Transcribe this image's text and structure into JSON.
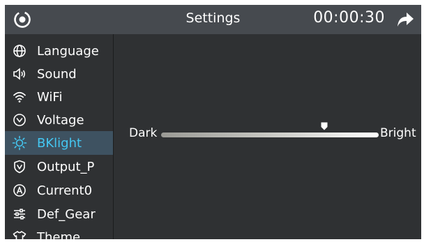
{
  "header": {
    "title": "Settings",
    "timer": "00:00:30"
  },
  "sidebar": {
    "items": [
      {
        "label": "Language",
        "icon": "globe-icon"
      },
      {
        "label": "Sound",
        "icon": "speaker-icon"
      },
      {
        "label": "WiFi",
        "icon": "wifi-icon"
      },
      {
        "label": "Voltage",
        "icon": "chevron-circle-icon"
      },
      {
        "label": "BKlight",
        "icon": "sun-icon",
        "active": true
      },
      {
        "label": "Output_P",
        "icon": "shield-icon"
      },
      {
        "label": "Current0",
        "icon": "a-circle-icon"
      },
      {
        "label": "Def_Gear",
        "icon": "sliders-icon"
      },
      {
        "label": "Theme",
        "icon": "shirt-icon"
      }
    ]
  },
  "backlight": {
    "min_label": "Dark",
    "max_label": "Bright",
    "level_fraction": 0.75
  },
  "colors": {
    "accent": "#44c7f2",
    "header_bg": "#464a4f",
    "panel_bg": "#2f3133",
    "active_bg": "#3e5261"
  }
}
